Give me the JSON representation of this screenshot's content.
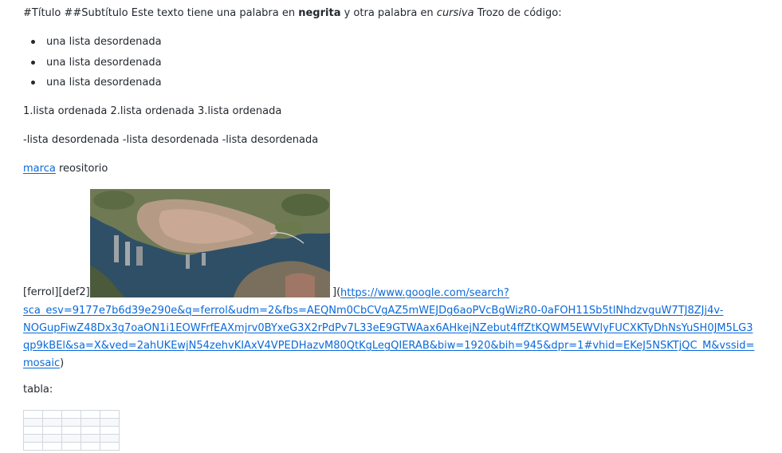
{
  "paragraph1": {
    "before_bold": "#Título ##Subtítulo Este texto tiene una palabra en ",
    "bold": "negrita",
    "between": " y otra palabra en ",
    "italic": "cursiva",
    "after": " Trozo de código:"
  },
  "bullet_list": [
    "una lista desordenada",
    "una lista desordenada",
    "una lista desordenada"
  ],
  "ordered_text": "1.lista ordenada 2.lista ordenada 3.lista ordenada",
  "dash_text": "-lista desordenada -lista desordenada -lista desordenada",
  "link_para": {
    "link_text": "marca",
    "after": " reositorio"
  },
  "image_line": {
    "prefix": "[ferrol][def2]",
    "suffix": "](",
    "url_lines": [
      "https://www.google.com/search?",
      "sca_esv=9177e7b6d39e290e&q=ferrol&udm=2&fbs=AEQNm0CbCVgAZ5mWEJDg6aoPVcBgWizR0-0aFOH11Sb5tlNhdzvguW7TJ8ZJj4v-",
      "NOGupFiwZ48Dx3g7oaON1i1EOWFrfEAXmjrv0BYxeG3X2rPdPv7L33eE9GTWAax6AHkejNZebut4ffZtKQWM5EWVlyFUCXKTyDhNsYuSH0JM5LG3",
      "qp9kBEl&sa=X&ved=2ahUKEwjN54zehvKIAxV4VPEDHazvM80QtKgLegQIERAB&biw=1920&bih=945&dpr=1#vhid=EKeJ5NSKTjQC_M&vssid=",
      "mosaic"
    ],
    "close": ")"
  },
  "tabla_label": "tabla:",
  "colors": {
    "link": "#0969da",
    "text": "#24292f",
    "table_border": "#d0d7de"
  },
  "table": {
    "rows": 5,
    "cols": 5
  }
}
